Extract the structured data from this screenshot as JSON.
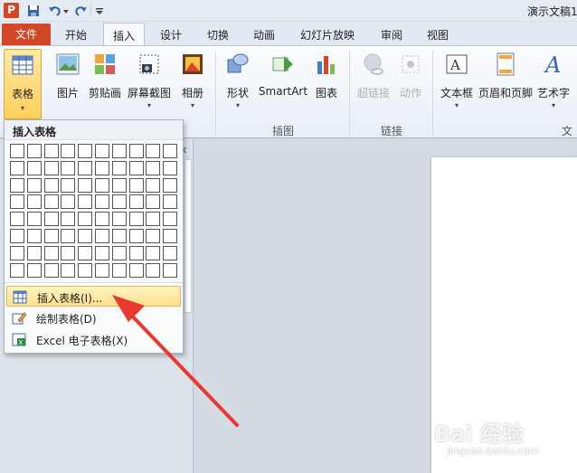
{
  "window": {
    "title": "演示文稿1"
  },
  "quick_access": {
    "save_icon": "save-icon",
    "undo_icon": "undo-icon",
    "redo_icon": "redo-icon"
  },
  "tabs": {
    "file": "文件",
    "items": [
      "开始",
      "插入",
      "设计",
      "切换",
      "动画",
      "幻灯片放映",
      "审阅",
      "视图"
    ],
    "active": "插入"
  },
  "ribbon": {
    "table": "表格",
    "picture": "图片",
    "clipart": "剪贴画",
    "screenshot": "屏幕截图",
    "album": "相册",
    "shapes": "形状",
    "smartart": "SmartArt",
    "chart": "图表",
    "hyperlink": "超链接",
    "action": "动作",
    "textbox": "文本框",
    "header_footer": "页眉和页脚",
    "wordart": "艺术字",
    "groups": {
      "illustrations": "插图",
      "links": "链接",
      "text": "文本"
    }
  },
  "dropdown": {
    "title": "插入表格",
    "grid_columns": 10,
    "grid_rows": 8,
    "items": [
      {
        "label": "插入表格(I)...",
        "highlighted": true
      },
      {
        "label": "绘制表格(D)"
      },
      {
        "label": "Excel 电子表格(X)"
      }
    ]
  },
  "watermark": {
    "text": "Bai 经验",
    "sub": "jingyan.baidu.com"
  },
  "colors": {
    "file_tab": "#d24726",
    "arrow": "#e8382f",
    "highlight": "#ffe08a"
  }
}
